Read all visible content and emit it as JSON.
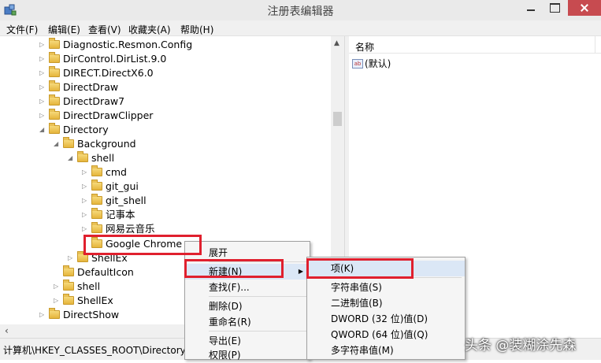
{
  "window": {
    "title": "注册表编辑器"
  },
  "menubar": [
    "文件(F)",
    "编辑(E)",
    "查看(V)",
    "收藏夹(A)",
    "帮助(H)"
  ],
  "tree": {
    "items": [
      {
        "label": "Diagnostic.Resmon.Config",
        "expand": "▷"
      },
      {
        "label": "DirControl.DirList.9.0",
        "expand": "▷"
      },
      {
        "label": "DIRECT.DirectX6.0",
        "expand": "▷"
      },
      {
        "label": "DirectDraw",
        "expand": "▷"
      },
      {
        "label": "DirectDraw7",
        "expand": "▷"
      },
      {
        "label": "DirectDrawClipper",
        "expand": "▷"
      },
      {
        "label": "Directory",
        "expand": "◢"
      },
      {
        "label": "Background",
        "expand": "◢"
      },
      {
        "label": "shell",
        "expand": "◢"
      },
      {
        "label": "cmd",
        "expand": "▷"
      },
      {
        "label": "git_gui",
        "expand": "▷"
      },
      {
        "label": "git_shell",
        "expand": "▷"
      },
      {
        "label": "记事本",
        "expand": "▷"
      },
      {
        "label": "网易云音乐",
        "expand": "▷"
      },
      {
        "label": "Google Chrome",
        "expand": ""
      },
      {
        "label": "ShellEx",
        "expand": "▷"
      },
      {
        "label": "DefaultIcon",
        "expand": ""
      },
      {
        "label": "shell",
        "expand": "▷"
      },
      {
        "label": "ShellEx",
        "expand": "▷"
      },
      {
        "label": "DirectShow",
        "expand": "▷"
      }
    ]
  },
  "list": {
    "column_name": "名称",
    "rows": [
      {
        "icon_text": "ab",
        "name": "(默认)"
      }
    ]
  },
  "status": {
    "path": "计算机\\HKEY_CLASSES_ROOT\\Directory"
  },
  "context_menu": {
    "items": [
      "展开",
      "新建(N)",
      "查找(F)...",
      "删除(D)",
      "重命名(R)",
      "导出(E)",
      "权限(P)"
    ],
    "submenu_arrow": "▶"
  },
  "new_submenu": {
    "items": [
      "项(K)",
      "字符串值(S)",
      "二进制值(B)",
      "DWORD (32 位)值(D)",
      "QWORD (64 位)值(Q)",
      "多字符串值(M)"
    ]
  },
  "watermark": "头条 @装糊涂先森",
  "colors": {
    "highlight_border": "#e0202e",
    "menu_hover": "#dbe7f6",
    "close_button": "#c74b50"
  }
}
